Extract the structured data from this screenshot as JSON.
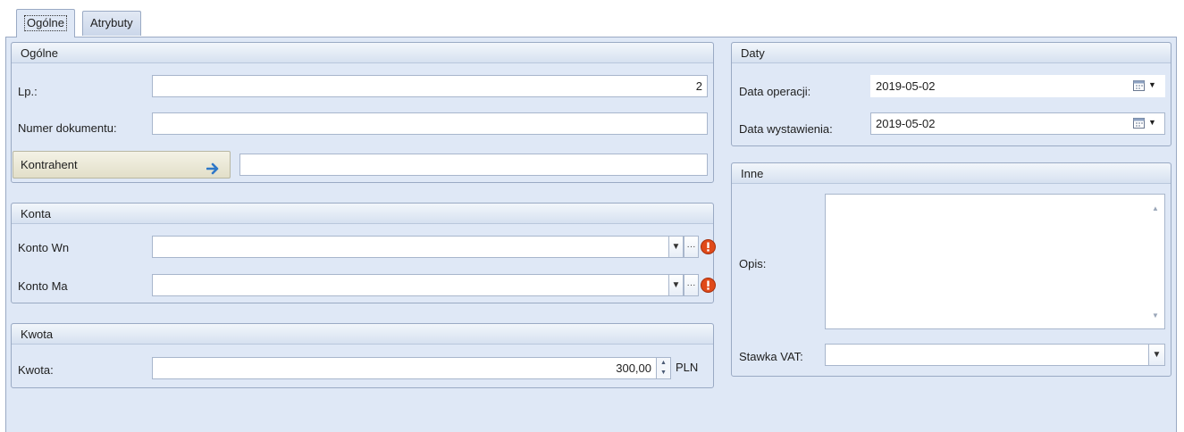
{
  "tabs": [
    {
      "label": "Ogólne",
      "active": true
    },
    {
      "label": "Atrybuty",
      "active": false
    }
  ],
  "ogolne": {
    "title": "Ogólne",
    "lp_label": "Lp.:",
    "lp_value": "2",
    "numer_label": "Numer dokumentu:",
    "numer_value": "",
    "kontrahent_button": "Kontrahent",
    "kontrahent_value": ""
  },
  "konta": {
    "title": "Konta",
    "wn_label": "Konto Wn",
    "wn_value": "",
    "ma_label": "Konto Ma",
    "ma_value": "",
    "ellipsis": "···",
    "dropdown_glyph": "▼"
  },
  "kwota": {
    "title": "Kwota",
    "label": "Kwota:",
    "value": "300,00",
    "currency": "PLN",
    "spin_up": "▲",
    "spin_down": "▼"
  },
  "daty": {
    "title": "Daty",
    "operacji_label": "Data operacji:",
    "operacji_value": "2019-05-02",
    "wystawienia_label": "Data wystawienia:",
    "wystawienia_value": "2019-05-02",
    "dropdown_glyph": "▼"
  },
  "inne": {
    "title": "Inne",
    "opis_label": "Opis:",
    "opis_value": "",
    "stawka_label": "Stawka VAT:",
    "stawka_value": "",
    "dropdown_glyph": "▼",
    "scroll_up": "▲",
    "scroll_down": "▼"
  },
  "colors": {
    "panel_bg": "#dfe8f6",
    "border": "#9aaac4",
    "kontrahent_bg": "#ebe8d5",
    "error_icon": "#e04a1a",
    "arrow_icon": "#2f78c8"
  }
}
